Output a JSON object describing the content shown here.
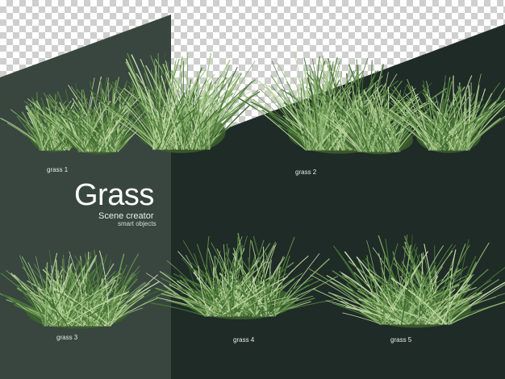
{
  "title": "Grass",
  "subtitle": "Scene creator",
  "tagline": "smart objects",
  "labels": {
    "grass1": "grass 1",
    "grass2": "grass 2",
    "grass3": "grass 3",
    "grass4": "grass 4",
    "grass5": "grass 5"
  },
  "colors": {
    "left_panel": "#38463f",
    "right_panel": "#1f2b27",
    "grass_dark": "#4f7a3c",
    "grass_light": "#a9c98c"
  }
}
